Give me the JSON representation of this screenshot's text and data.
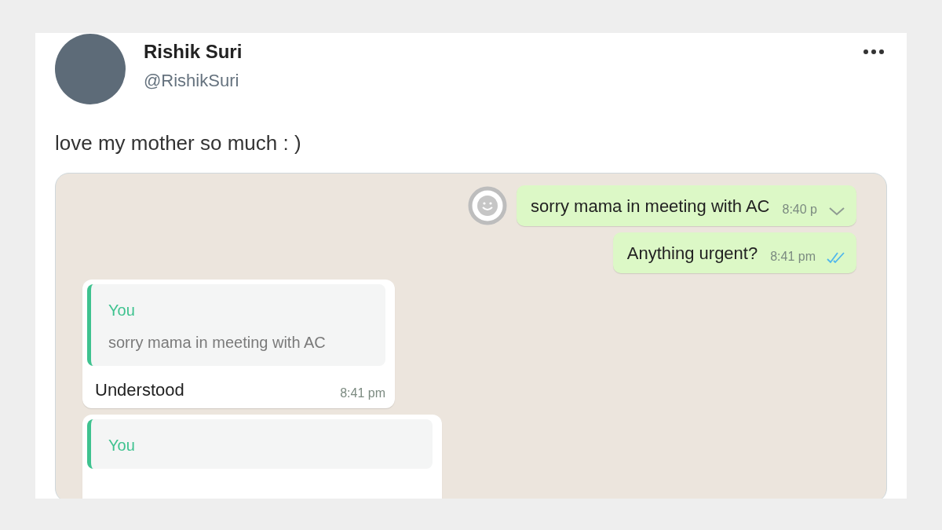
{
  "tweet": {
    "author_name": "Rishik Suri",
    "handle": "@RishikSuri",
    "text": "love my mother so much : )"
  },
  "chat": {
    "messages": [
      {
        "kind": "outgoing",
        "text": "sorry mama in meeting with AC",
        "time": "8:40 p",
        "hovered": true
      },
      {
        "kind": "outgoing",
        "text": "Anything urgent?",
        "time": "8:41 pm",
        "hovered": false,
        "read": true
      },
      {
        "kind": "incoming",
        "quote": {
          "author": "You",
          "text": "sorry mama in meeting with AC"
        },
        "text": "Understood",
        "time": "8:41 pm"
      },
      {
        "kind": "incoming",
        "quote": {
          "author": "You"
        }
      }
    ]
  }
}
